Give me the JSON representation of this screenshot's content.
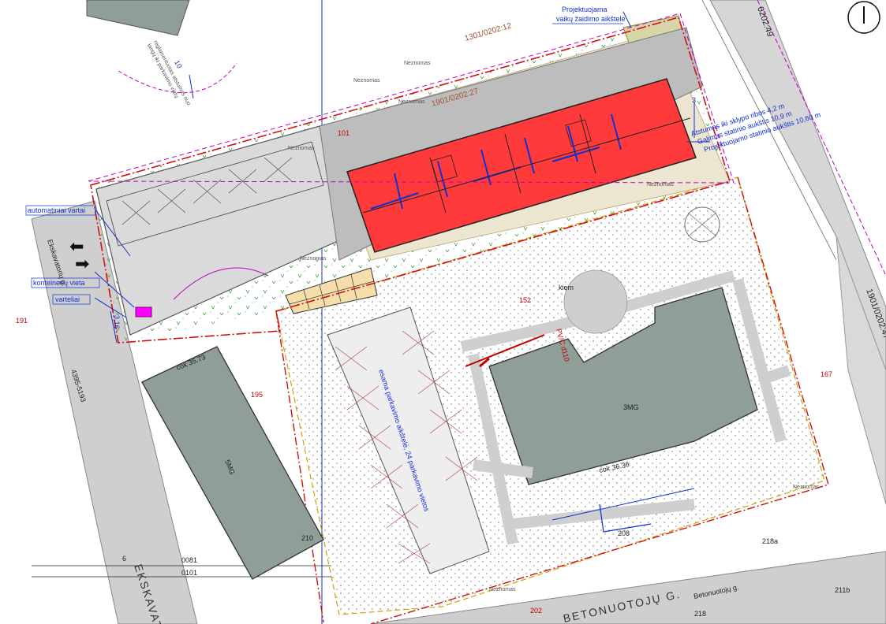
{
  "colors": {
    "building_new": "#ff3a3a",
    "building_existing": "#8f9e96",
    "road": "#cfcfcf",
    "paving": "#bdbdbd",
    "plot_boundary": "#d01010",
    "neighbor_boundary": "#c000c0",
    "annotation": "#1030d0",
    "green_area_border": "#d0a000",
    "playground": "#d8d6a8",
    "parking_stalls": "#f6deaa",
    "container_spot": "#ff00ff"
  },
  "north_symbol": "north-arrow-icon",
  "parcels": {
    "top": "1301/0202:12",
    "plot": "1901/0202:27",
    "right_top": "0202:49",
    "right_mid": "1901/0202:47"
  },
  "streets": {
    "left": "EKSKAVATO",
    "left_small": "Ekskavatorių g.",
    "bottom": "BETONUOTOJŲ G.",
    "bottom_small": "Betonuotojų g."
  },
  "annotations": {
    "playground": [
      "Projektuojama",
      "vaikų žaidimo aikštelė"
    ],
    "distances": [
      "Atstumas iki sklypo ribos 4,2 m",
      "Galimas statinio aukštis 10,9 m",
      "Projektuojamo statinio aukštis 10,60 m"
    ],
    "gates": "automatiniai vartai",
    "containers": "konteinerių vieta",
    "wicket": "varteliai",
    "parking": "esama parkavimo aikštelė, 24 parkavimo vietos",
    "top_left_note": [
      "10",
      "reglamentuotas atstumas nuo",
      "langų iki parkavimo vietų"
    ],
    "existing_building_right": "3MG",
    "existing_building_left": "5MG",
    "roundabout": "kiem",
    "pipe": "PV/C d110",
    "stub_left_dim": "3,16",
    "ext_dim": "3"
  },
  "house_numbers": [
    "101",
    "152",
    "195",
    "210",
    "202",
    "208",
    "218",
    "218a",
    "211b",
    "167",
    "191"
  ],
  "labels": {
    "cok_left": "cok 35.73",
    "cok_right": "cok 36.36",
    "grid_a": "6",
    "grid_b": "0081",
    "grid_c": "0101",
    "coord": "4395-5193"
  },
  "tree_label": "Neznomas",
  "glyphs": {
    "arrow_in": "➡",
    "arrow_out": "⬅"
  }
}
